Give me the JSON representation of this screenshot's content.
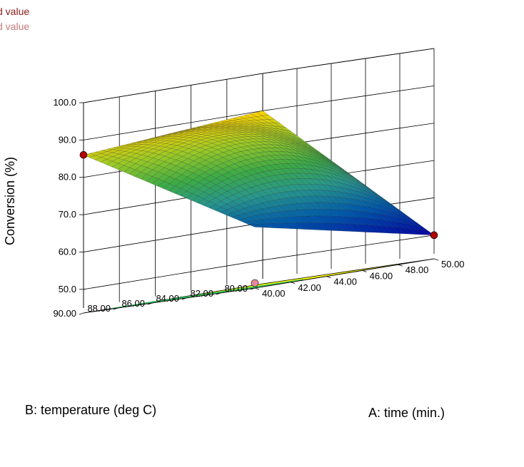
{
  "chart_data": {
    "type": "surface3d",
    "title": "",
    "legend": {
      "entries": [
        {
          "label": "d value",
          "color": "#8B1A1A"
        },
        {
          "label": "d value",
          "color": "#C47A7A"
        }
      ],
      "placement": "top-left"
    },
    "xlabel": "A: time (min.)",
    "ylabel": "B: temperature (deg C)",
    "zlabel": "Conversion (%)",
    "x_ticks": [
      "40.00",
      "42.00",
      "44.00",
      "46.00",
      "48.00",
      "50.00"
    ],
    "y_ticks": [
      "80.00",
      "82.00",
      "84.00",
      "86.00",
      "88.00",
      "90.00"
    ],
    "z_ticks": [
      "50.0",
      "60.0",
      "70.0",
      "80.0",
      "90.0",
      "100.0"
    ],
    "xlim": [
      40,
      50
    ],
    "ylim": [
      80,
      90
    ],
    "zlim": [
      45,
      100
    ],
    "surface_corners": [
      {
        "time": 40,
        "temperature": 80,
        "conversion": 60
      },
      {
        "time": 40,
        "temperature": 90,
        "conversion": 86
      },
      {
        "time": 50,
        "temperature": 90,
        "conversion": 90
      },
      {
        "time": 50,
        "temperature": 80,
        "conversion": 50
      }
    ],
    "design_points": [
      {
        "time": 40,
        "temperature": 90,
        "conversion": 86,
        "color": "#B00000"
      },
      {
        "time": 50,
        "temperature": 80,
        "conversion": 50,
        "color": "#B00000"
      },
      {
        "time": 40,
        "temperature": 80,
        "conversion": 45,
        "color": "#E58A9A"
      }
    ],
    "colors": {
      "floor": "#FFFF00",
      "contour": "#2FBF5F",
      "surface_low": "#0000A0",
      "surface_high": "#FFD000"
    }
  }
}
